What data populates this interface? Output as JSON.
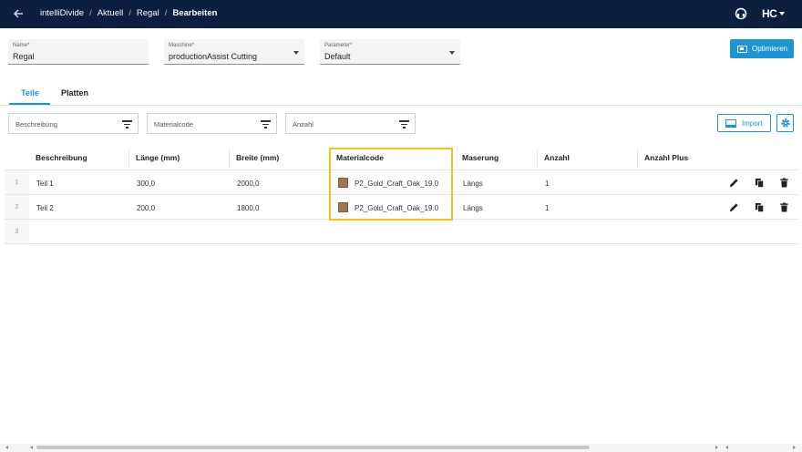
{
  "header": {
    "breadcrumbs": [
      "intelliDivide",
      "Aktuell",
      "Regal",
      "Bearbeiten"
    ],
    "separator": "/",
    "logo_text": "HC",
    "icons": [
      "back-arrow-icon",
      "support-icon",
      "chevron-down-icon"
    ]
  },
  "form": {
    "name": {
      "label": "Name*",
      "value": "Regal"
    },
    "machine": {
      "label": "Maschine*",
      "value": "productionAssist Cutting"
    },
    "parameter": {
      "label": "Parameter*",
      "value": "Default"
    },
    "optimize_label": "Optimieren"
  },
  "tabs": [
    {
      "label": "Teile",
      "active": true
    },
    {
      "label": "Platten",
      "active": false
    }
  ],
  "filters": {
    "description": "Beschreibung",
    "material": "Materialcode",
    "count": "Anzahl",
    "import_label": "Import"
  },
  "table": {
    "columns": [
      "Beschreibung",
      "Länge (mm)",
      "Breite (mm)",
      "Materialcode",
      "Maserung",
      "Anzahl",
      "Anzahl Plus"
    ],
    "rows": [
      {
        "num": "1",
        "desc": "Teil 1",
        "length": "300,0",
        "width": "2000,0",
        "material": "P2_Gold_Craft_Oak_19.0",
        "grain": "Längs",
        "count": "1",
        "count_plus": ""
      },
      {
        "num": "2",
        "desc": "Teil 2",
        "length": "200,0",
        "width": "1800,0",
        "material": "P2_Gold_Craft_Oak_19.0",
        "grain": "Längs",
        "count": "1",
        "count_plus": ""
      }
    ],
    "empty_row_num": "3"
  },
  "colors": {
    "header_bg": "#0b1f3f",
    "accent": "#1e94d2",
    "highlight": "#f2c320",
    "swatch": "#a07454"
  }
}
